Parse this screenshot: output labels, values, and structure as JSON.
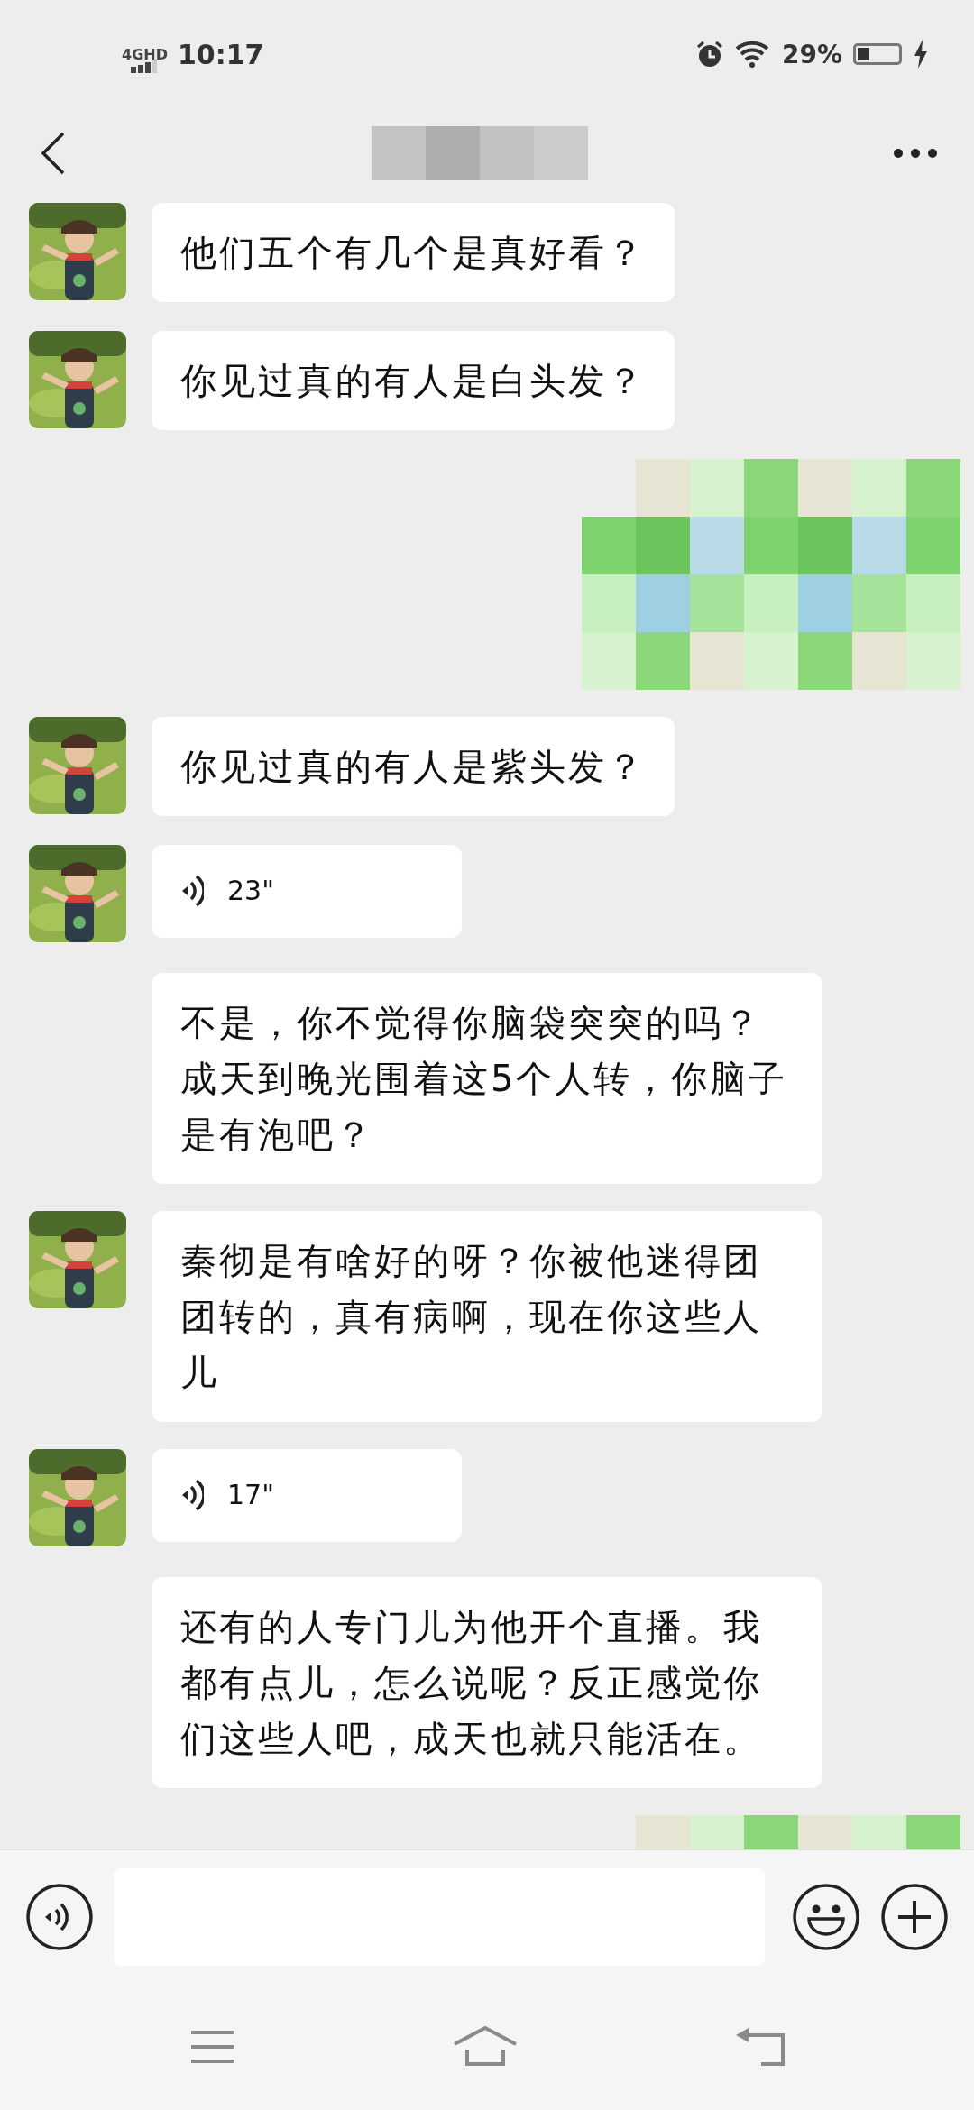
{
  "status_bar": {
    "network": "4GHD",
    "time": "10:17",
    "battery": "29%"
  },
  "messages": [
    {
      "kind": "text",
      "avatar": true,
      "text": "他们五个有几个是真好看？"
    },
    {
      "kind": "text",
      "avatar": true,
      "text": "你见过真的有人是白头发？"
    },
    {
      "kind": "redacted"
    },
    {
      "kind": "text",
      "avatar": true,
      "text": "你见过真的有人是紫头发？"
    },
    {
      "kind": "voice",
      "avatar": true,
      "duration": "23\""
    },
    {
      "kind": "text",
      "avatar": false,
      "text": "不是，你不觉得你脑袋突突的吗？成天到晚光围着这5个人转，你脑子是有泡吧？"
    },
    {
      "kind": "text",
      "avatar": true,
      "text": "秦彻是有啥好的呀？你被他迷得团团转的，真有病啊，现在你这些人儿"
    },
    {
      "kind": "voice",
      "avatar": true,
      "duration": "17\""
    },
    {
      "kind": "text",
      "avatar": false,
      "text": "还有的人专门儿为他开个直播。我都有点儿，怎么说呢？反正感觉你们这些人吧，成天也就只能活在。"
    },
    {
      "kind": "redacted"
    }
  ]
}
